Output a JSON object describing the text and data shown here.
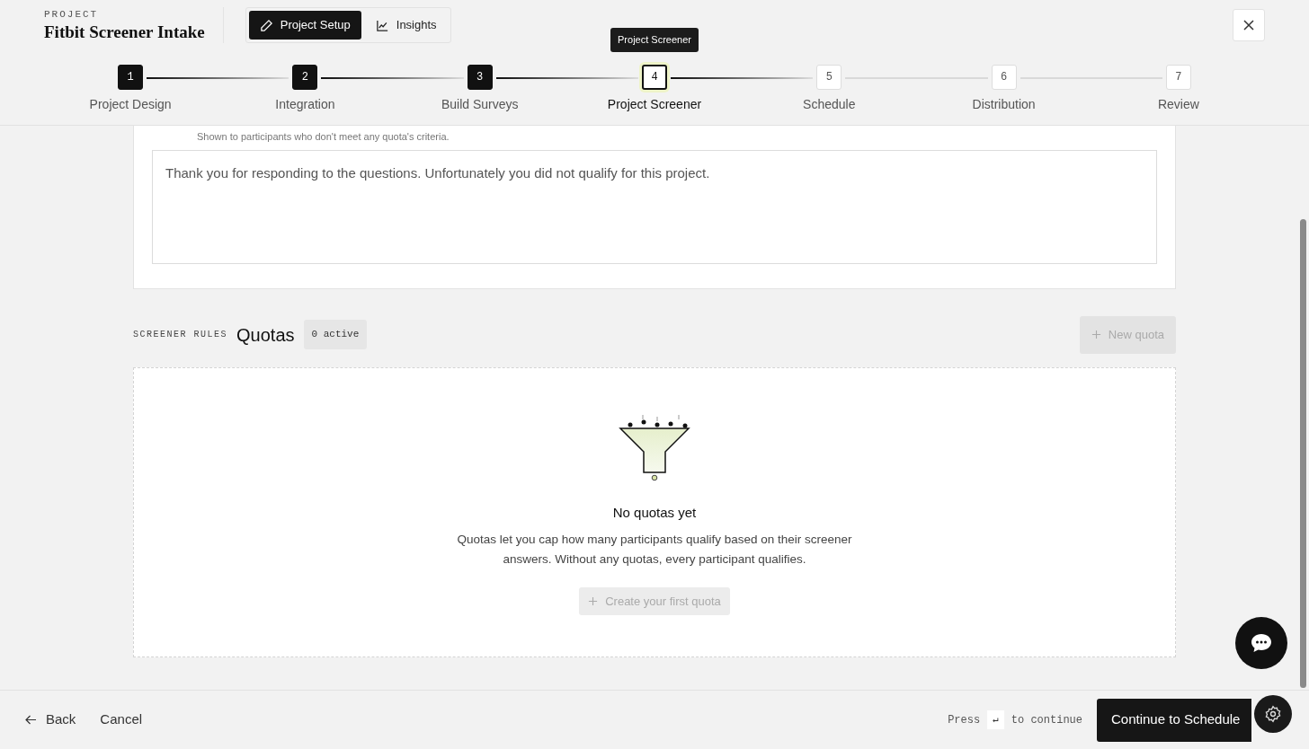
{
  "header": {
    "eyebrow": "PROJECT",
    "title": "Fitbit Screener Intake",
    "modes": [
      {
        "label": "Project Setup",
        "selected": true
      },
      {
        "label": "Insights",
        "selected": false
      }
    ]
  },
  "tooltip": "Project Screener",
  "steps": [
    {
      "number": "1",
      "label": "Project Design",
      "completed": true,
      "selected": false
    },
    {
      "number": "2",
      "label": "Integration",
      "completed": true,
      "selected": false
    },
    {
      "number": "3",
      "label": "Build Surveys",
      "completed": true,
      "selected": false
    },
    {
      "number": "4",
      "label": "Project Screener",
      "completed": false,
      "selected": true
    },
    {
      "number": "5",
      "label": "Schedule",
      "completed": false,
      "selected": false
    },
    {
      "number": "6",
      "label": "Distribution",
      "completed": false,
      "selected": false
    },
    {
      "number": "7",
      "label": "Review",
      "completed": false,
      "selected": false
    }
  ],
  "disqualify": {
    "hint": "Shown to participants who don't meet any quota's criteria.",
    "message": "Thank you for responding to the questions. Unfortunately you did not qualify for this project."
  },
  "quotas": {
    "eyebrow": "SCREENER RULES",
    "title": "Quotas",
    "count_badge": "0 active",
    "new_button": "New quota",
    "new_disabled": true,
    "empty": {
      "title": "No quotas yet",
      "text": "Quotas let you cap how many participants qualify based on their screener answers. Without any quotas, every participant qualifies.",
      "button": "Create your first quota",
      "button_disabled": true
    }
  },
  "footer": {
    "back": "Back",
    "cancel": "Cancel",
    "press": "Press",
    "key": "↵",
    "to_continue": "to continue",
    "continue": "Continue to Schedule"
  }
}
